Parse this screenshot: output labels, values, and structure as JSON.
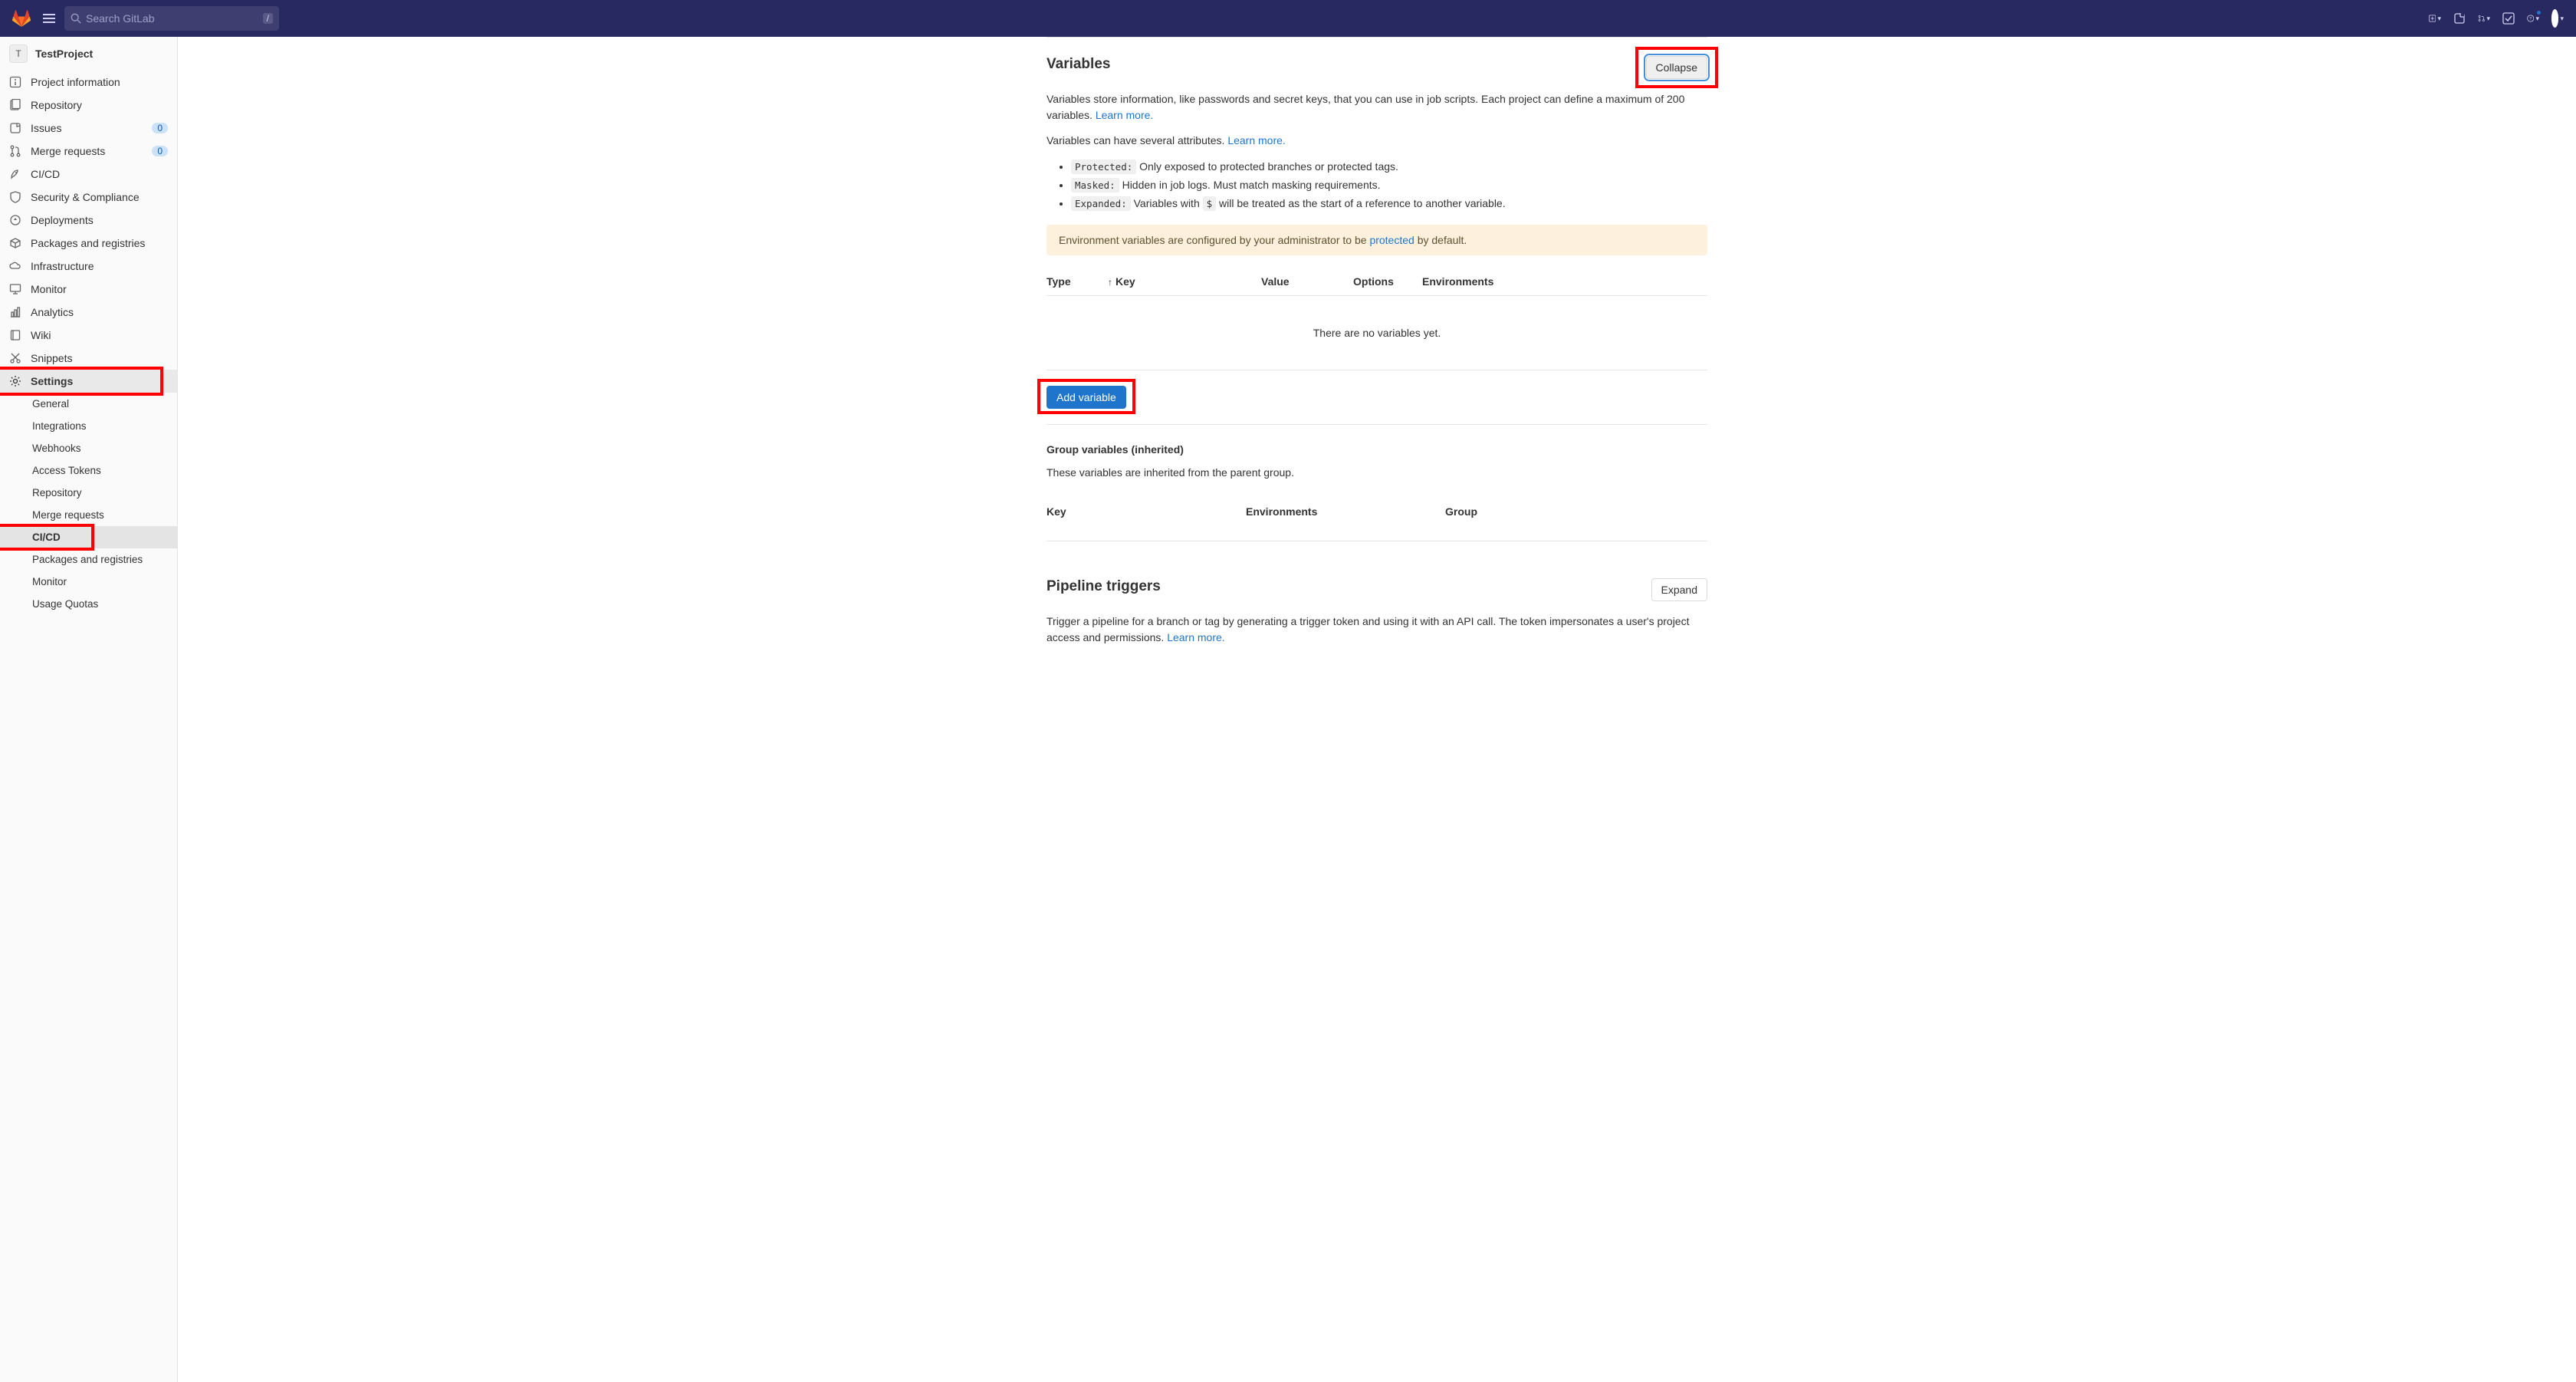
{
  "topbar": {
    "search_placeholder": "Search GitLab",
    "search_kbd": "/",
    "mr_count": "",
    "todo_count": ""
  },
  "sidebar": {
    "project_avatar": "T",
    "project_name": "TestProject",
    "items": [
      {
        "icon": "info",
        "label": "Project information"
      },
      {
        "icon": "repo",
        "label": "Repository"
      },
      {
        "icon": "issues",
        "label": "Issues",
        "badge": "0"
      },
      {
        "icon": "mr",
        "label": "Merge requests",
        "badge": "0"
      },
      {
        "icon": "cicd",
        "label": "CI/CD"
      },
      {
        "icon": "security",
        "label": "Security & Compliance"
      },
      {
        "icon": "deploy",
        "label": "Deployments"
      },
      {
        "icon": "packages",
        "label": "Packages and registries"
      },
      {
        "icon": "infra",
        "label": "Infrastructure"
      },
      {
        "icon": "monitor",
        "label": "Monitor"
      },
      {
        "icon": "analytics",
        "label": "Analytics"
      },
      {
        "icon": "wiki",
        "label": "Wiki"
      },
      {
        "icon": "snippets",
        "label": "Snippets"
      },
      {
        "icon": "settings",
        "label": "Settings",
        "active": true
      }
    ],
    "settings_sub": [
      {
        "label": "General"
      },
      {
        "label": "Integrations"
      },
      {
        "label": "Webhooks"
      },
      {
        "label": "Access Tokens"
      },
      {
        "label": "Repository"
      },
      {
        "label": "Merge requests"
      },
      {
        "label": "CI/CD",
        "active": true
      },
      {
        "label": "Packages and registries"
      },
      {
        "label": "Monitor"
      },
      {
        "label": "Usage Quotas"
      }
    ]
  },
  "variables": {
    "title": "Variables",
    "collapse_btn": "Collapse",
    "desc_line1": "Variables store information, like passwords and secret keys, that you can use in job scripts. Each project can define a maximum of 200 variables. ",
    "learn_more": "Learn more.",
    "desc_line2": "Variables can have several attributes. ",
    "attrs": [
      {
        "name": "Protected:",
        "desc": " Only exposed to protected branches or protected tags."
      },
      {
        "name": "Masked:",
        "desc": " Hidden in job logs. Must match masking requirements."
      },
      {
        "name": "Expanded:",
        "desc_prefix": " Variables with ",
        "code": "$",
        "desc_suffix": " will be treated as the start of a reference to another variable."
      }
    ],
    "admin_alert_prefix": "Environment variables are configured by your administrator to be ",
    "admin_alert_link": "protected",
    "admin_alert_suffix": " by default.",
    "headers": {
      "type": "Type",
      "key": "Key",
      "value": "Value",
      "options": "Options",
      "environments": "Environments"
    },
    "empty": "There are no variables yet.",
    "add_btn": "Add variable",
    "group_title": "Group variables (inherited)",
    "group_desc": "These variables are inherited from the parent group.",
    "group_headers": {
      "key": "Key",
      "environments": "Environments",
      "group": "Group"
    }
  },
  "triggers": {
    "title": "Pipeline triggers",
    "expand_btn": "Expand",
    "desc": "Trigger a pipeline for a branch or tag by generating a trigger token and using it with an API call. The token impersonates a user's project access and permissions. ",
    "learn_more": "Learn more."
  }
}
